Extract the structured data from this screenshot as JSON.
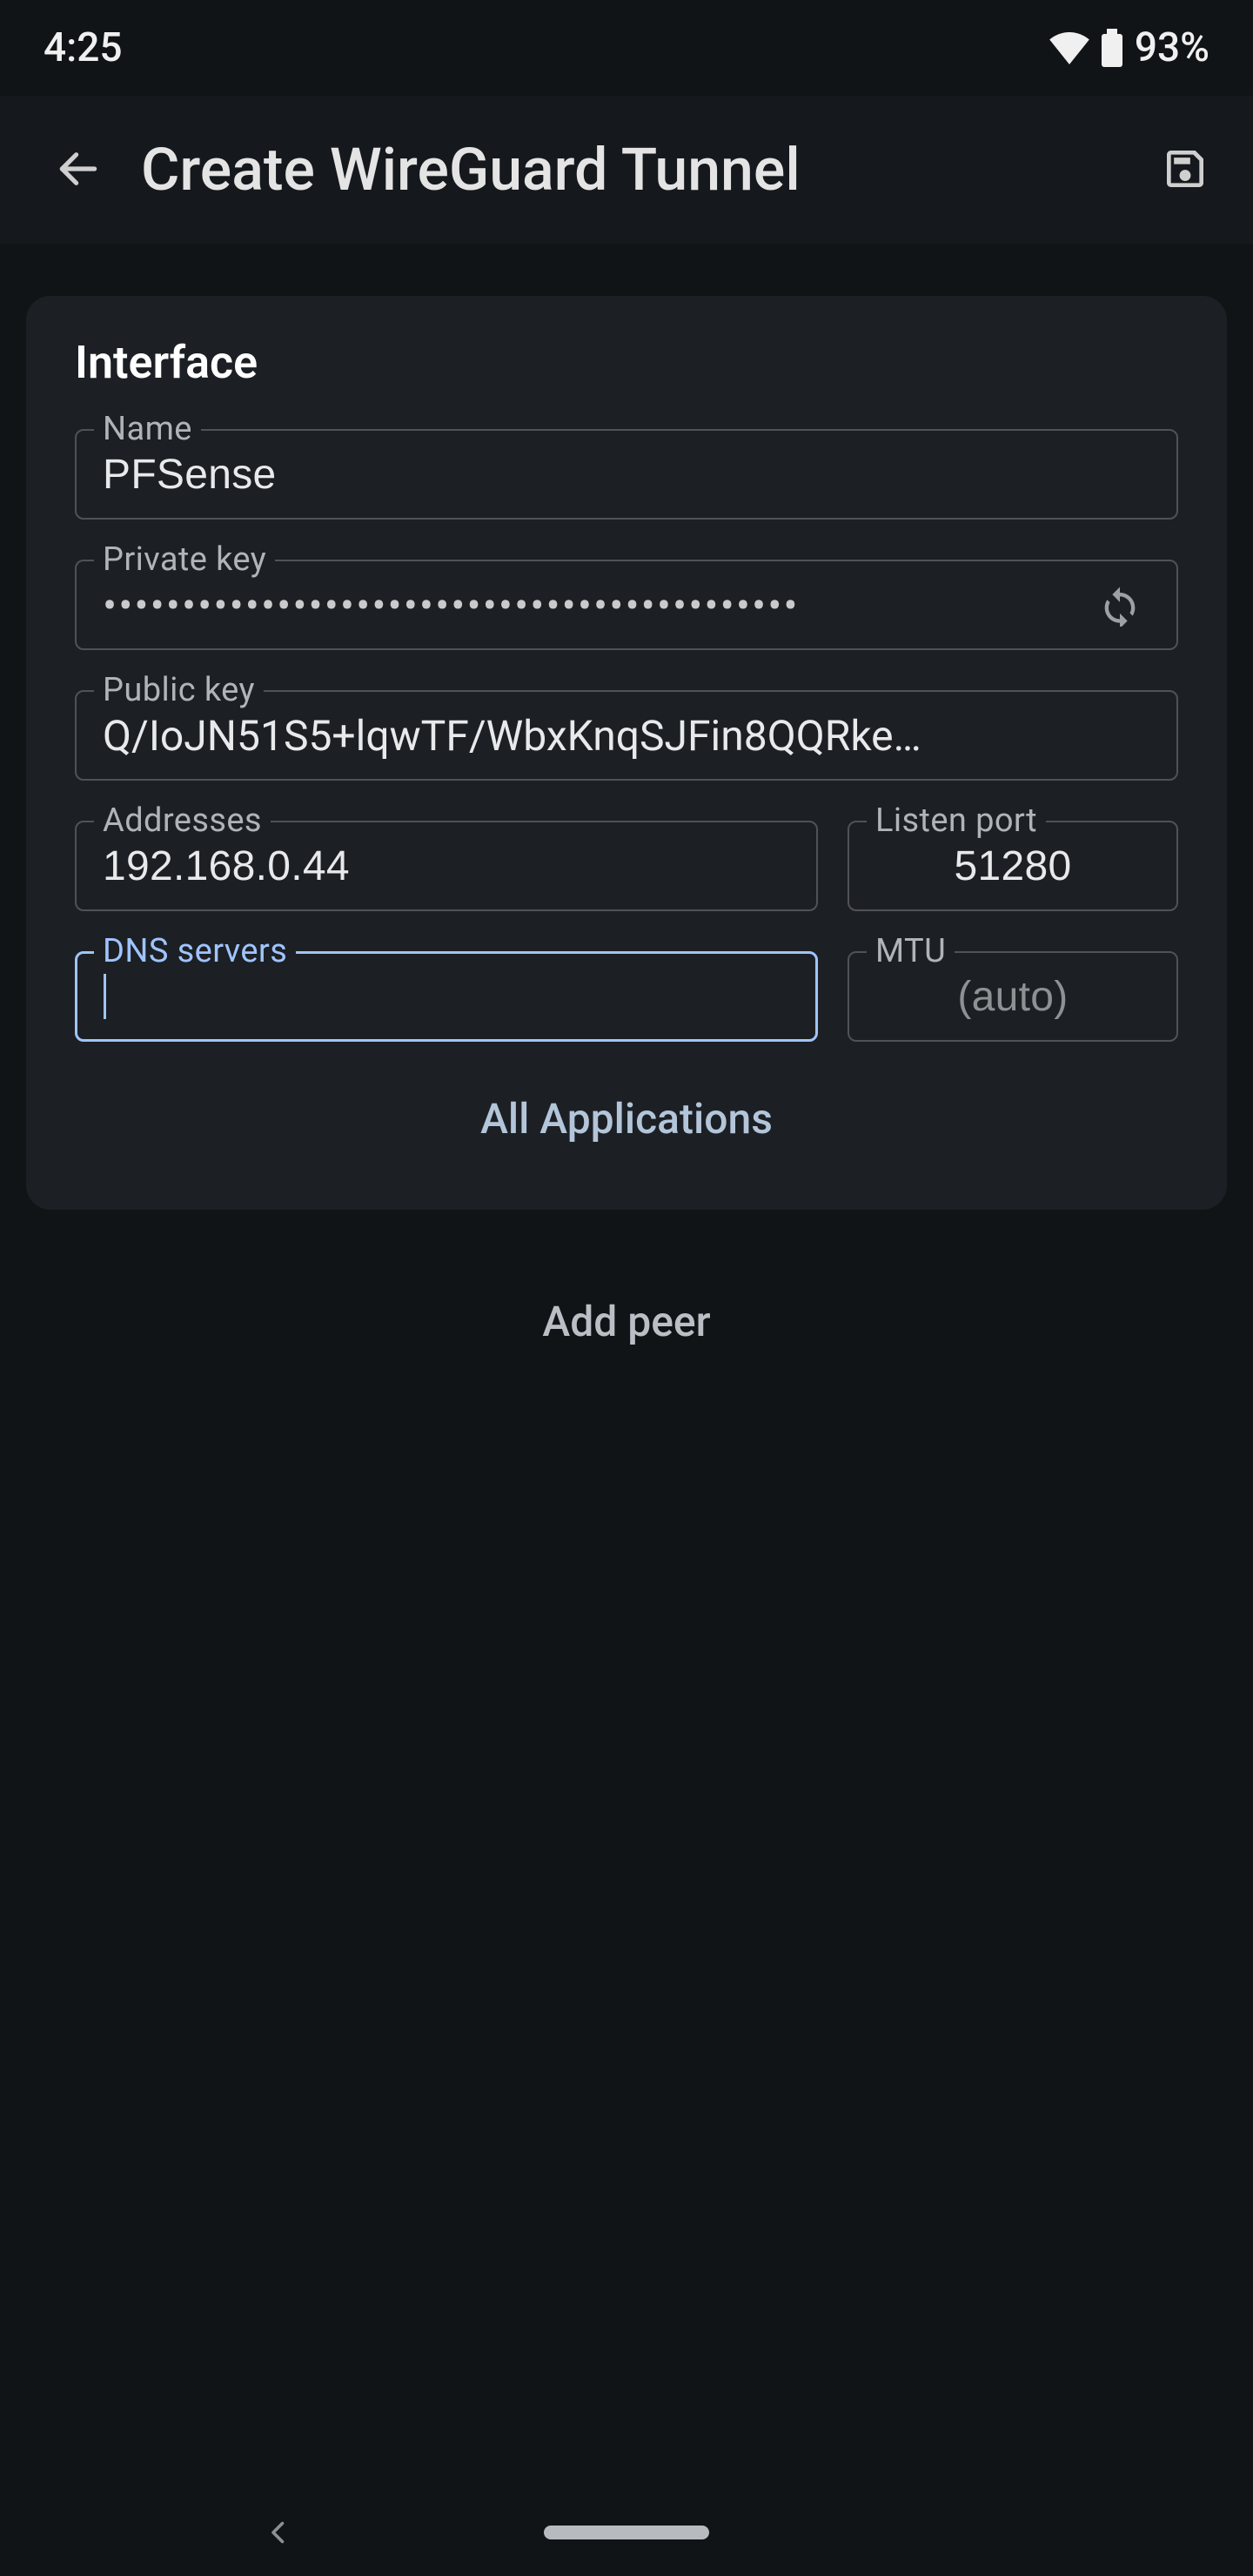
{
  "status": {
    "time": "4:25",
    "battery_pct": "93%"
  },
  "appbar": {
    "title": "Create WireGuard Tunnel"
  },
  "interface": {
    "section_title": "Interface",
    "name": {
      "label": "Name",
      "value": "PFSense"
    },
    "private_key": {
      "label": "Private key",
      "masked": "••••••••••••••••••••••••••••••••••••••••••••"
    },
    "public_key": {
      "label": "Public key",
      "value": "Q/IoJN51S5+lqwTF/WbxKnqSJFin8QQRke…"
    },
    "addresses": {
      "label": "Addresses",
      "value": "192.168.0.44"
    },
    "listen_port": {
      "label": "Listen port",
      "value": "51280"
    },
    "dns": {
      "label": "DNS servers",
      "value": ""
    },
    "mtu": {
      "label": "MTU",
      "placeholder": "(auto)"
    },
    "all_apps_label": "All Applications"
  },
  "add_peer_label": "Add peer"
}
